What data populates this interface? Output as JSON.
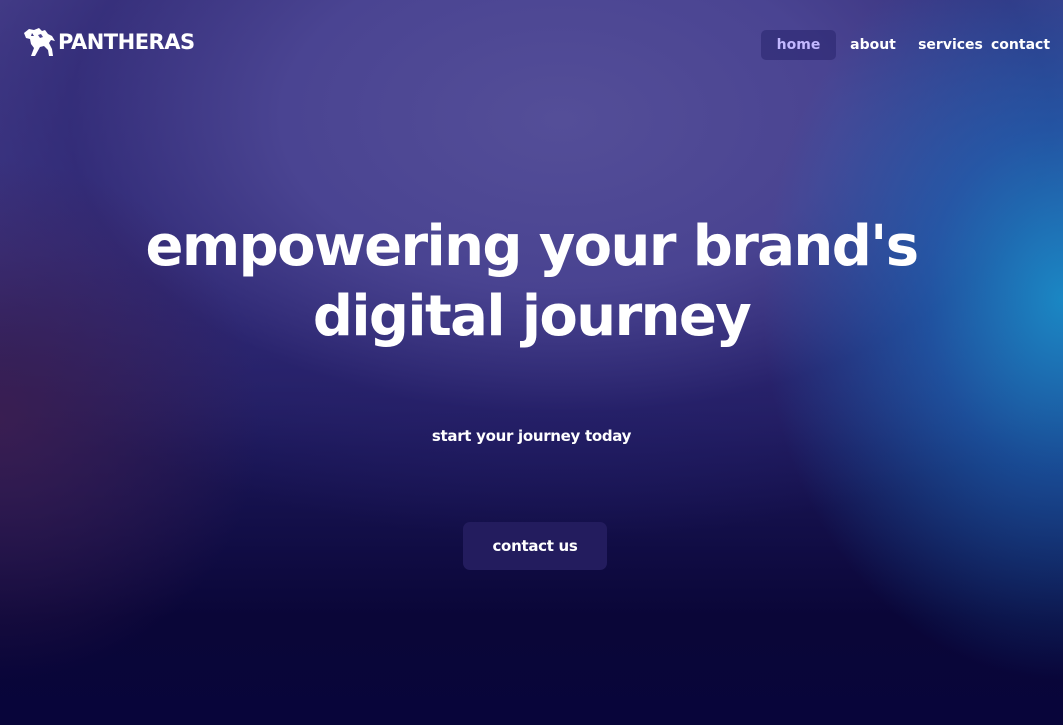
{
  "brand": {
    "name": "PANTHERAS",
    "logo_icon": "panther-logo-icon"
  },
  "nav": {
    "items": [
      {
        "label": "home",
        "active": true
      },
      {
        "label": "about",
        "active": false
      },
      {
        "label": "services",
        "active": false
      },
      {
        "label": "contact",
        "active": false
      }
    ]
  },
  "hero": {
    "title_line1": "empowering your brand's",
    "title_line2": "digital journey",
    "subtitle": "start your journey today",
    "cta_label": "contact us"
  },
  "colors": {
    "active_nav_text": "#c2b8ff",
    "cta_background": "#231c5e",
    "text": "#ffffff"
  }
}
